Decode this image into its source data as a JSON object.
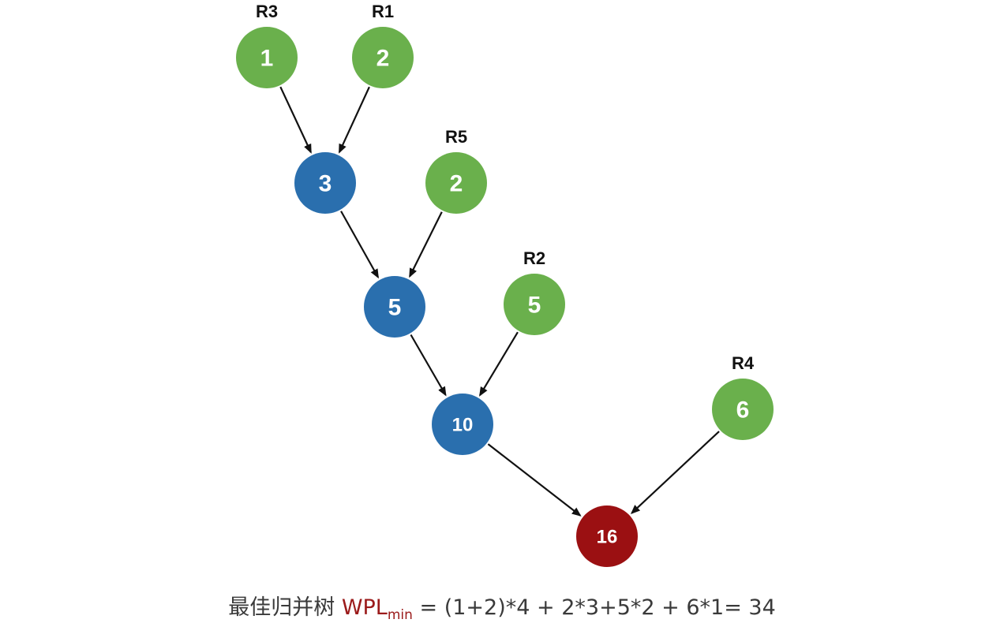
{
  "colors": {
    "leaf": "#6ab04c",
    "internal": "#2a6fae",
    "root": "#9b1012",
    "edge": "#111111"
  },
  "nodes": [
    {
      "id": "n1",
      "value": "1",
      "kind": "leaf",
      "label": "R3"
    },
    {
      "id": "n2",
      "value": "2",
      "kind": "leaf",
      "label": "R1"
    },
    {
      "id": "n3",
      "value": "3",
      "kind": "internal",
      "label": ""
    },
    {
      "id": "n4",
      "value": "2",
      "kind": "leaf",
      "label": "R5"
    },
    {
      "id": "n5",
      "value": "5",
      "kind": "internal",
      "label": ""
    },
    {
      "id": "n6",
      "value": "5",
      "kind": "leaf",
      "label": "R2"
    },
    {
      "id": "n10",
      "value": "10",
      "kind": "internal",
      "label": ""
    },
    {
      "id": "n7",
      "value": "6",
      "kind": "leaf",
      "label": "R4"
    },
    {
      "id": "n16",
      "value": "16",
      "kind": "root",
      "label": ""
    }
  ],
  "edges": [
    {
      "from": "n1",
      "to": "n3"
    },
    {
      "from": "n2",
      "to": "n3"
    },
    {
      "from": "n3",
      "to": "n5"
    },
    {
      "from": "n4",
      "to": "n5"
    },
    {
      "from": "n5",
      "to": "n10"
    },
    {
      "from": "n6",
      "to": "n10"
    },
    {
      "from": "n10",
      "to": "n16"
    },
    {
      "from": "n7",
      "to": "n16"
    }
  ],
  "formula": {
    "prefix": "最佳归并树",
    "wpl": "WPL",
    "wpl_sub": "min",
    "expression": "= (1+2)*4 + 2*3+5*2 + 6*1= 34"
  }
}
